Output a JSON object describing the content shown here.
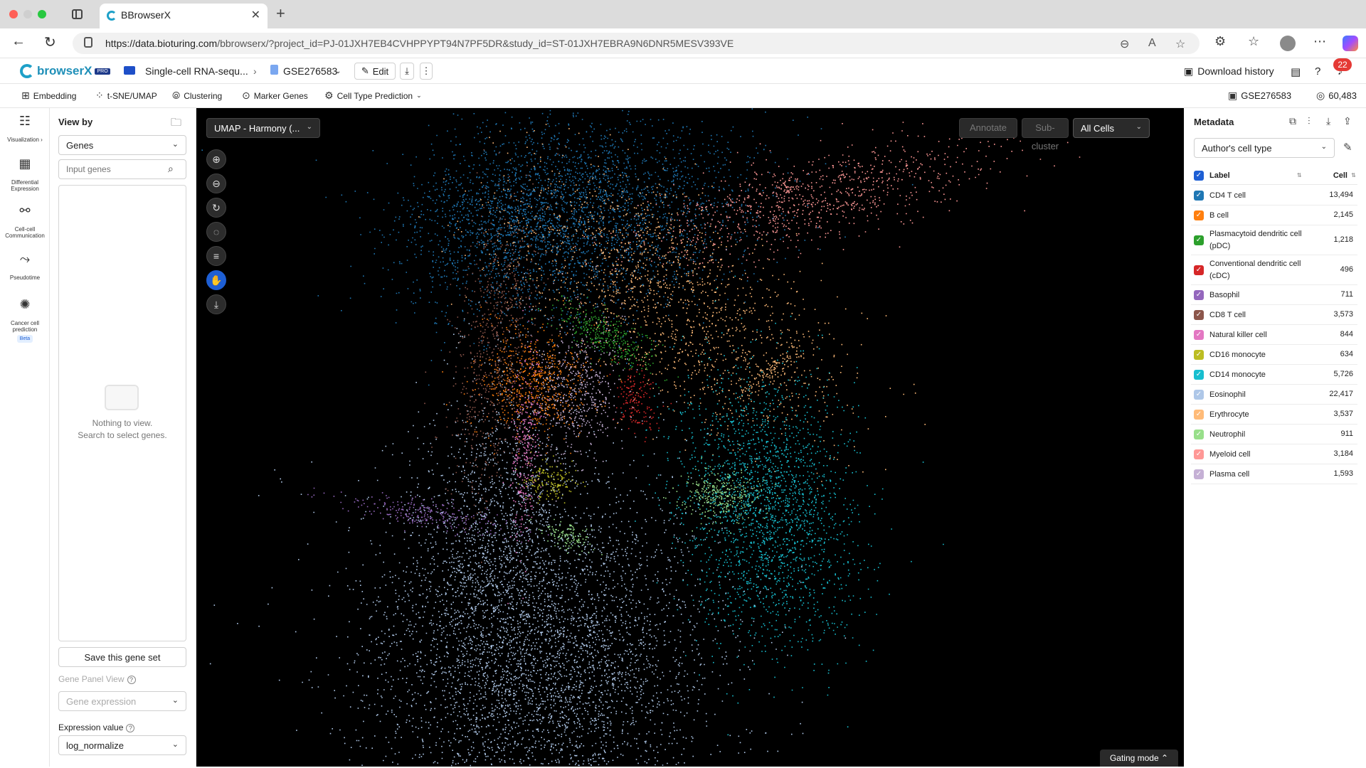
{
  "browser": {
    "tab_title": "BBrowserX",
    "url_domain": "https://data.bioturing.com",
    "url_path": "/bbrowserx/?project_id=PJ-01JXH7EB4CVHPPYPT94N7PF5DR&study_id=ST-01JXH7EBRA9N6DNR5MESV393VE"
  },
  "header": {
    "logo_text": "browserX",
    "logo_badge": "PRO",
    "project": "Single-cell RNA-sequ...",
    "study": "GSE276583",
    "edit_label": "Edit",
    "download_history": "Download history",
    "notification_count": "22"
  },
  "toolbar": {
    "items": [
      "Embedding",
      "t-SNE/UMAP",
      "Clustering",
      "Marker Genes",
      "Cell Type Prediction"
    ],
    "study_id": "GSE276583",
    "cell_total": "60,483"
  },
  "rail": {
    "items": [
      "Visualization",
      "Differential Expression",
      "Cell-cell Communication",
      "Pseudotime",
      "Cancer cell prediction"
    ],
    "beta": "Beta"
  },
  "left_panel": {
    "title": "View by",
    "view_by": "Genes",
    "gene_placeholder": "Input genes",
    "empty_line1": "Nothing to view.",
    "empty_line2": "Search to select genes.",
    "save_gene_set": "Save this gene set",
    "gene_panel_view_label": "Gene Panel View",
    "gene_panel_view_value": "Gene expression",
    "expression_label": "Expression value",
    "expression_value": "log_normalize"
  },
  "canvas": {
    "embedding": "UMAP - Harmony (...",
    "annotate": "Annotate",
    "subcluster": "Sub-cluster",
    "cells_filter": "All Cells",
    "gating_mode": "Gating mode"
  },
  "metadata": {
    "title": "Metadata",
    "group": "Author's cell type",
    "col_label": "Label",
    "col_cell": "Cell",
    "rows": [
      {
        "label": "CD4 T cell",
        "count": "13,494",
        "color": "#1f77b4"
      },
      {
        "label": "B cell",
        "count": "2,145",
        "color": "#ff7f0e"
      },
      {
        "label": "Plasmacytoid dendritic cell (pDC)",
        "count": "1,218",
        "color": "#2ca02c"
      },
      {
        "label": "Conventional dendritic cell (cDC)",
        "count": "496",
        "color": "#d62728"
      },
      {
        "label": "Basophil",
        "count": "711",
        "color": "#9467bd"
      },
      {
        "label": "CD8 T cell",
        "count": "3,573",
        "color": "#8c564b"
      },
      {
        "label": "Natural killer cell",
        "count": "844",
        "color": "#e377c2"
      },
      {
        "label": "CD16 monocyte",
        "count": "634",
        "color": "#bcbd22"
      },
      {
        "label": "CD14 monocyte",
        "count": "5,726",
        "color": "#17becf"
      },
      {
        "label": "Eosinophil",
        "count": "22,417",
        "color": "#aec7e8"
      },
      {
        "label": "Erythrocyte",
        "count": "3,537",
        "color": "#ffbb78"
      },
      {
        "label": "Neutrophil",
        "count": "911",
        "color": "#98df8a"
      },
      {
        "label": "Myeloid cell",
        "count": "3,184",
        "color": "#ff9896"
      },
      {
        "label": "Plasma cell",
        "count": "1,593",
        "color": "#c5b0d5"
      }
    ]
  }
}
